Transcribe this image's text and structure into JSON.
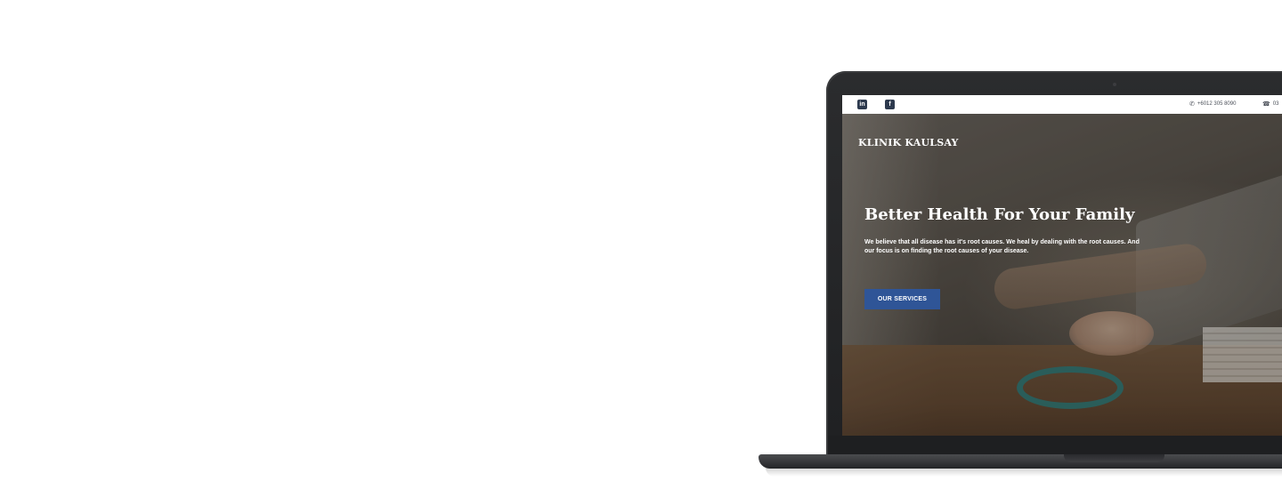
{
  "site": {
    "brand": "KLINIK KAULSAY",
    "topbar": {
      "social": [
        {
          "name": "linkedin-icon",
          "glyph": "in"
        },
        {
          "name": "facebook-icon",
          "glyph": "f"
        }
      ],
      "whatsapp": "+6012 305 8090",
      "phone": "03"
    },
    "hero": {
      "title": "Better Health For Your Family",
      "text": "We believe that all disease has it's root causes. We heal by dealing with the root causes. And our focus is on finding the root causes of your disease.",
      "cta": "OUR SERVICES"
    }
  },
  "colors": {
    "cta_background": "#2f5597",
    "laptop_body": "#2b2c2e",
    "topbar_background": "#ffffff"
  }
}
